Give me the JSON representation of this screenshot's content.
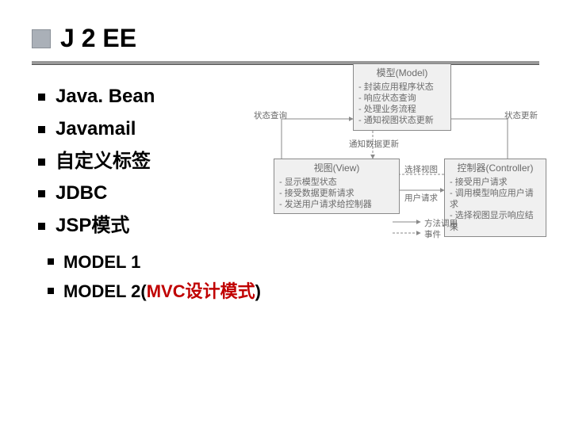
{
  "title": "J 2 EE",
  "bullets": [
    "Java. Bean",
    "Javamail",
    "自定义标签",
    "JDBC",
    "JSP模式"
  ],
  "sub_bullets": {
    "model1": "MODEL 1",
    "model2_prefix": "MODEL 2(",
    "model2_mvc": "MVC设计模式",
    "model2_suffix": ")"
  },
  "diagram": {
    "model": {
      "title": "模型(Model)",
      "lines": [
        "- 封装应用程序状态",
        "- 响应状态查询",
        "- 处理业务流程",
        "- 通知视图状态更新"
      ]
    },
    "view": {
      "title": "视图(View)",
      "lines": [
        "- 显示模型状态",
        "- 接受数据更新请求",
        "- 发送用户请求给控制器"
      ]
    },
    "controller": {
      "title": "控制器(Controller)",
      "lines": [
        "- 接受用户请求",
        "- 调用模型响应用户请求",
        "- 选择视图显示响应结果"
      ]
    },
    "labels": {
      "status_query": "状态查询",
      "notify_update": "通知数据更新",
      "status_update": "状态更新",
      "select_view": "选择视图",
      "user_request": "用户请求",
      "legend_call": "方法调用",
      "legend_event": "事件"
    }
  }
}
